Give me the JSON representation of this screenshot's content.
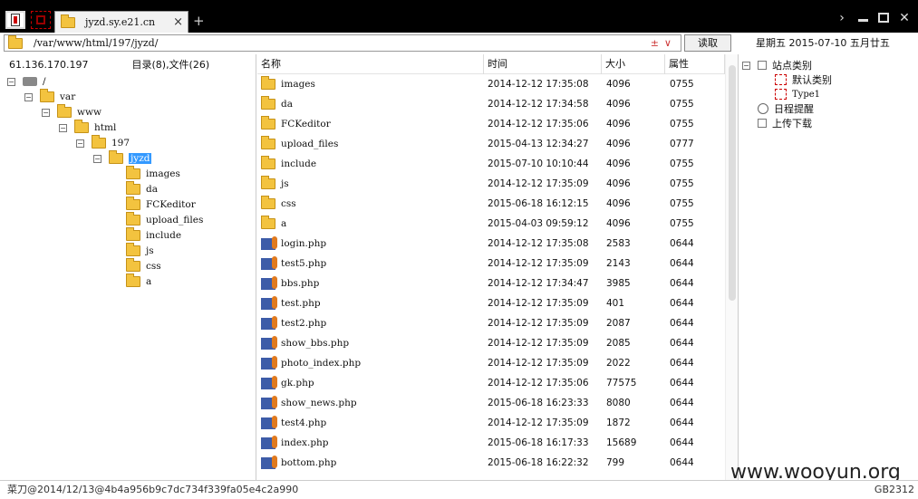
{
  "tab": {
    "title": "jyzd.sy.e21.cn",
    "close": "×",
    "new_tab": "+"
  },
  "window": {
    "arrow": "›",
    "close": "✕"
  },
  "address": {
    "path": "/var/www/html/197/jyzd/",
    "actions": "±∨",
    "read_button": "读取"
  },
  "datebar": "星期五  2015-07-10  五月廿五",
  "left_header": {
    "ip": "61.136.170.197",
    "summary": "目录(8),文件(26)"
  },
  "tree": [
    {
      "label": "/",
      "icon": "hdd",
      "level": 0,
      "exp": "−"
    },
    {
      "label": "var",
      "icon": "folder",
      "level": 1,
      "exp": "−"
    },
    {
      "label": "www",
      "icon": "folder",
      "level": 2,
      "exp": "−"
    },
    {
      "label": "html",
      "icon": "folder",
      "level": 3,
      "exp": "−"
    },
    {
      "label": "197",
      "icon": "folder",
      "level": 4,
      "exp": "−"
    },
    {
      "label": "jyzd",
      "icon": "folder",
      "level": 5,
      "exp": "−",
      "selected": true
    },
    {
      "label": "images",
      "icon": "folder",
      "level": 6
    },
    {
      "label": "da",
      "icon": "folder",
      "level": 6
    },
    {
      "label": "FCKeditor",
      "icon": "folder",
      "level": 6
    },
    {
      "label": "upload_files",
      "icon": "folder",
      "level": 6
    },
    {
      "label": "include",
      "icon": "folder",
      "level": 6
    },
    {
      "label": "js",
      "icon": "folder",
      "level": 6
    },
    {
      "label": "css",
      "icon": "folder",
      "level": 6
    },
    {
      "label": "a",
      "icon": "folder",
      "level": 6
    }
  ],
  "columns": {
    "name": "名称",
    "time": "时间",
    "size": "大小",
    "attr": "属性"
  },
  "files": [
    {
      "name": "images",
      "type": "folder",
      "time": "2014-12-12 17:35:08",
      "size": "4096",
      "attr": "0755"
    },
    {
      "name": "da",
      "type": "folder",
      "time": "2014-12-12 17:34:58",
      "size": "4096",
      "attr": "0755"
    },
    {
      "name": "FCKeditor",
      "type": "folder",
      "time": "2014-12-12 17:35:06",
      "size": "4096",
      "attr": "0755"
    },
    {
      "name": "upload_files",
      "type": "folder",
      "time": "2015-04-13 12:34:27",
      "size": "4096",
      "attr": "0777"
    },
    {
      "name": "include",
      "type": "folder",
      "time": "2015-07-10 10:10:44",
      "size": "4096",
      "attr": "0755"
    },
    {
      "name": "js",
      "type": "folder",
      "time": "2014-12-12 17:35:09",
      "size": "4096",
      "attr": "0755"
    },
    {
      "name": "css",
      "type": "folder",
      "time": "2015-06-18 16:12:15",
      "size": "4096",
      "attr": "0755"
    },
    {
      "name": "a",
      "type": "folder",
      "time": "2015-04-03 09:59:12",
      "size": "4096",
      "attr": "0755"
    },
    {
      "name": "login.php",
      "type": "php",
      "time": "2014-12-12 17:35:08",
      "size": "2583",
      "attr": "0644"
    },
    {
      "name": "test5.php",
      "type": "php",
      "time": "2014-12-12 17:35:09",
      "size": "2143",
      "attr": "0644"
    },
    {
      "name": "bbs.php",
      "type": "php",
      "time": "2014-12-12 17:34:47",
      "size": "3985",
      "attr": "0644"
    },
    {
      "name": "test.php",
      "type": "php",
      "time": "2014-12-12 17:35:09",
      "size": "401",
      "attr": "0644"
    },
    {
      "name": "test2.php",
      "type": "php",
      "time": "2014-12-12 17:35:09",
      "size": "2087",
      "attr": "0644"
    },
    {
      "name": "show_bbs.php",
      "type": "php",
      "time": "2014-12-12 17:35:09",
      "size": "2085",
      "attr": "0644"
    },
    {
      "name": "photo_index.php",
      "type": "php",
      "time": "2014-12-12 17:35:09",
      "size": "2022",
      "attr": "0644"
    },
    {
      "name": "gk.php",
      "type": "php",
      "time": "2014-12-12 17:35:06",
      "size": "77575",
      "attr": "0644"
    },
    {
      "name": "show_news.php",
      "type": "php",
      "time": "2015-06-18 16:23:33",
      "size": "8080",
      "attr": "0644"
    },
    {
      "name": "test4.php",
      "type": "php",
      "time": "2014-12-12 17:35:09",
      "size": "1872",
      "attr": "0644"
    },
    {
      "name": "index.php",
      "type": "php",
      "time": "2015-06-18 16:17:33",
      "size": "15689",
      "attr": "0644"
    },
    {
      "name": "bottom.php",
      "type": "php",
      "time": "2015-06-18 16:22:32",
      "size": "799",
      "attr": "0644"
    }
  ],
  "right_tree": {
    "category": "站点类别",
    "children": [
      "默认类别",
      "Type1"
    ],
    "reminder": "日程提醒",
    "upload": "上传下载"
  },
  "status": {
    "text": "菜刀@2014/12/13@4b4a956b9c7dc734f339fa05e4c2a990",
    "encoding": "GB2312"
  },
  "watermark": "www.wooyun.org"
}
